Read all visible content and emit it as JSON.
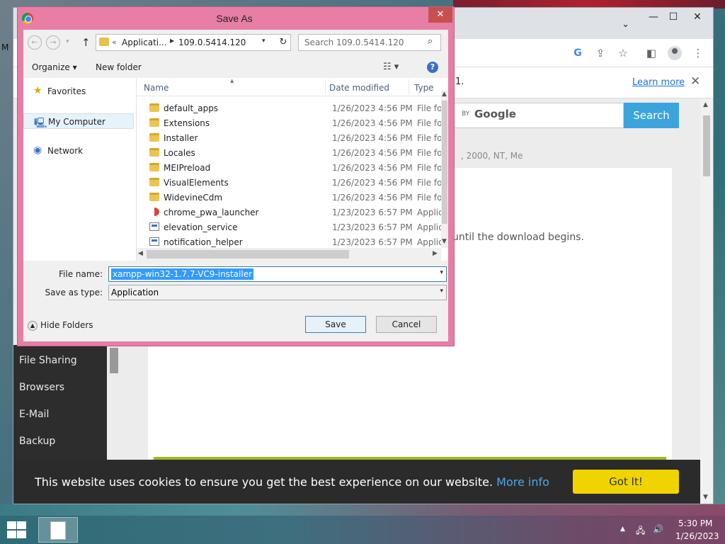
{
  "desktop": {
    "letter": "M"
  },
  "browser": {
    "window_controls": {
      "minimize": "—",
      "maximize": "☐",
      "close": "✕"
    },
    "infobar": {
      "text": "1.",
      "learn_more": "Learn more",
      "close": "✕"
    },
    "search": {
      "by": "BY",
      "google": "Google",
      "button": "Search"
    },
    "os_text": ", 2000, NT, Me",
    "download_text": "until the download begins.",
    "sidebar": [
      "File Sharing",
      "Browsers",
      "E-Mail",
      "Backup"
    ],
    "cookie": {
      "text": "This website uses cookies to ensure you get the best experience on our website.",
      "more": "More info",
      "button": "Got It!"
    }
  },
  "dialog": {
    "title": "Save As",
    "address": {
      "prefix": "«",
      "segment1": "Applicati...",
      "segment2": "109.0.5414.120"
    },
    "search_placeholder": "Search 109.0.5414.120",
    "toolbar": {
      "organize": "Organize ▾",
      "new_folder": "New folder"
    },
    "nav": [
      {
        "label": "Favorites",
        "icon": "star-icon"
      },
      {
        "label": "My Computer",
        "icon": "computer-icon"
      },
      {
        "label": "Network",
        "icon": "network-icon"
      }
    ],
    "columns": {
      "name": "Name",
      "date": "Date modified",
      "type": "Type"
    },
    "files": [
      {
        "name": "default_apps",
        "date": "1/26/2023 4:56 PM",
        "type": "File fol",
        "kind": "folder"
      },
      {
        "name": "Extensions",
        "date": "1/26/2023 4:56 PM",
        "type": "File fol",
        "kind": "folder"
      },
      {
        "name": "Installer",
        "date": "1/26/2023 4:56 PM",
        "type": "File fol",
        "kind": "folder"
      },
      {
        "name": "Locales",
        "date": "1/26/2023 4:56 PM",
        "type": "File fol",
        "kind": "folder"
      },
      {
        "name": "MEIPreload",
        "date": "1/26/2023 4:56 PM",
        "type": "File fol",
        "kind": "folder"
      },
      {
        "name": "VisualElements",
        "date": "1/26/2023 4:56 PM",
        "type": "File fol",
        "kind": "folder"
      },
      {
        "name": "WidevineCdm",
        "date": "1/26/2023 4:56 PM",
        "type": "File fol",
        "kind": "folder"
      },
      {
        "name": "chrome_pwa_launcher",
        "date": "1/23/2023 6:57 PM",
        "type": "Applic",
        "kind": "pwa"
      },
      {
        "name": "elevation_service",
        "date": "1/23/2023 6:57 PM",
        "type": "Applic",
        "kind": "app"
      },
      {
        "name": "notification_helper",
        "date": "1/23/2023 6:57 PM",
        "type": "Applic",
        "kind": "app"
      }
    ],
    "filename_label": "File name:",
    "filename_value": "xampp-win32-1.7.7-VC9-installer",
    "savetype_label": "Save as type:",
    "savetype_value": "Application",
    "hide_folders": "Hide Folders",
    "save_button": "Save",
    "cancel_button": "Cancel"
  },
  "taskbar": {
    "time": "5:30 PM",
    "date": "1/26/2023"
  }
}
